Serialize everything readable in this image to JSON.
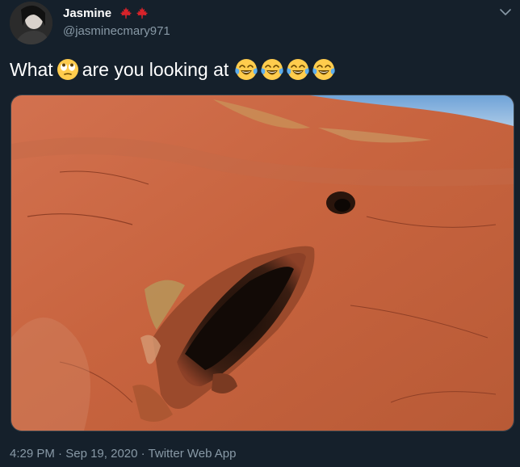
{
  "author": {
    "display_name": "Jasmine",
    "handle": "@jasminecmary971",
    "flags": [
      "maple-leaf-flag",
      "maple-leaf-flag"
    ]
  },
  "tweet": {
    "text_before": "What",
    "text_after": "are you looking at",
    "emojis": [
      "face-with-rolling-eyes",
      "face-with-tears-of-joy",
      "face-with-tears-of-joy",
      "face-with-tears-of-joy",
      "face-with-tears-of-joy"
    ],
    "media_description": "photo"
  },
  "meta": {
    "time": "4:29 PM",
    "date": "Sep 19, 2020",
    "source": "Twitter Web App",
    "separator": "·"
  },
  "colors": {
    "background": "#15202b",
    "secondary_text": "#8899a6",
    "flag_red": "#d8232a"
  },
  "icons": {
    "menu": "chevron-down-icon"
  }
}
